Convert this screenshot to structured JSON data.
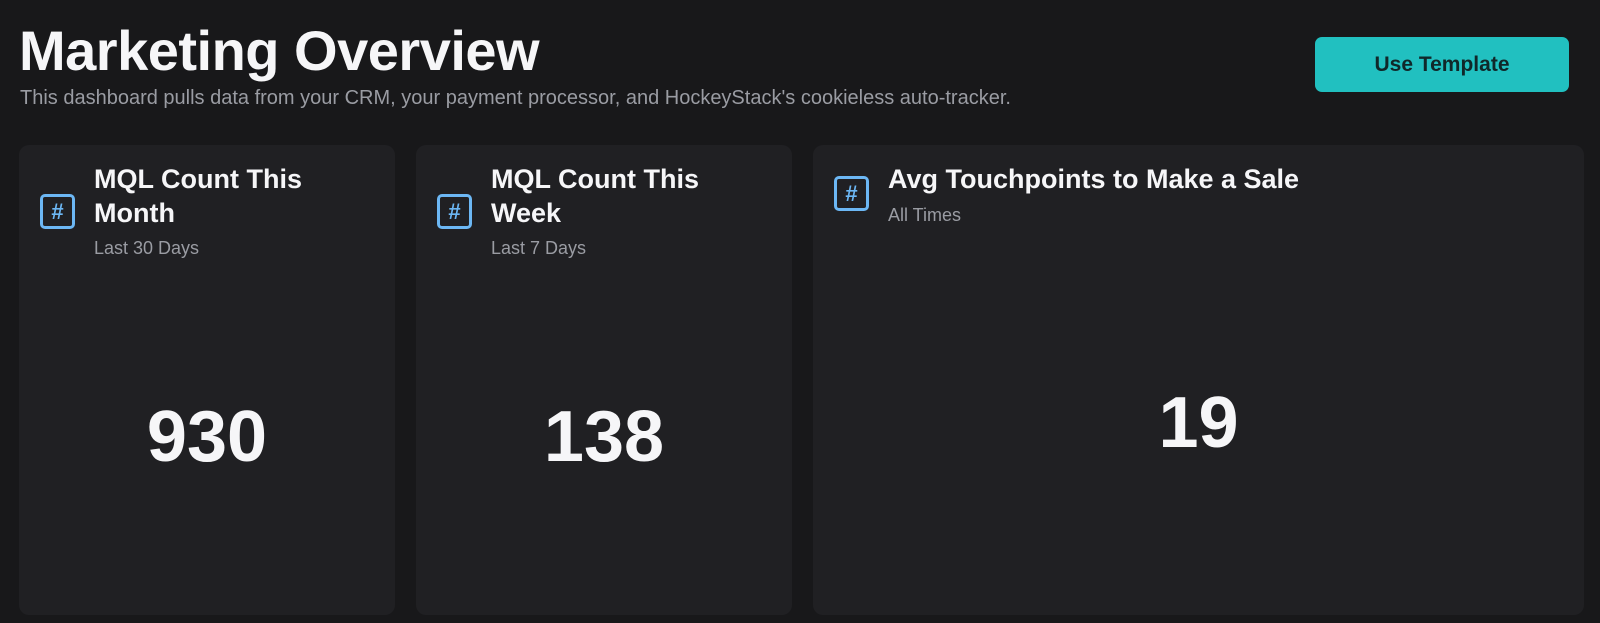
{
  "header": {
    "title": "Marketing Overview",
    "subtitle": "This dashboard pulls data from your CRM, your payment processor, and HockeyStack's cookieless auto-tracker.",
    "use_template_label": "Use Template"
  },
  "colors": {
    "background": "#18181a",
    "card": "#202023",
    "accent": "#21c0c0",
    "icon": "#6cb7f4",
    "muted_text": "#9a9ca3"
  },
  "cards": [
    {
      "icon": "hash-icon",
      "icon_glyph": "#",
      "title": "MQL Count This Month",
      "subtitle": "Last 30 Days",
      "value": "930"
    },
    {
      "icon": "hash-icon",
      "icon_glyph": "#",
      "title": "MQL Count This Week",
      "subtitle": "Last 7 Days",
      "value": "138"
    },
    {
      "icon": "hash-icon",
      "icon_glyph": "#",
      "title": "Avg Touchpoints to Make a Sale",
      "subtitle": "All Times",
      "value": "19"
    }
  ]
}
